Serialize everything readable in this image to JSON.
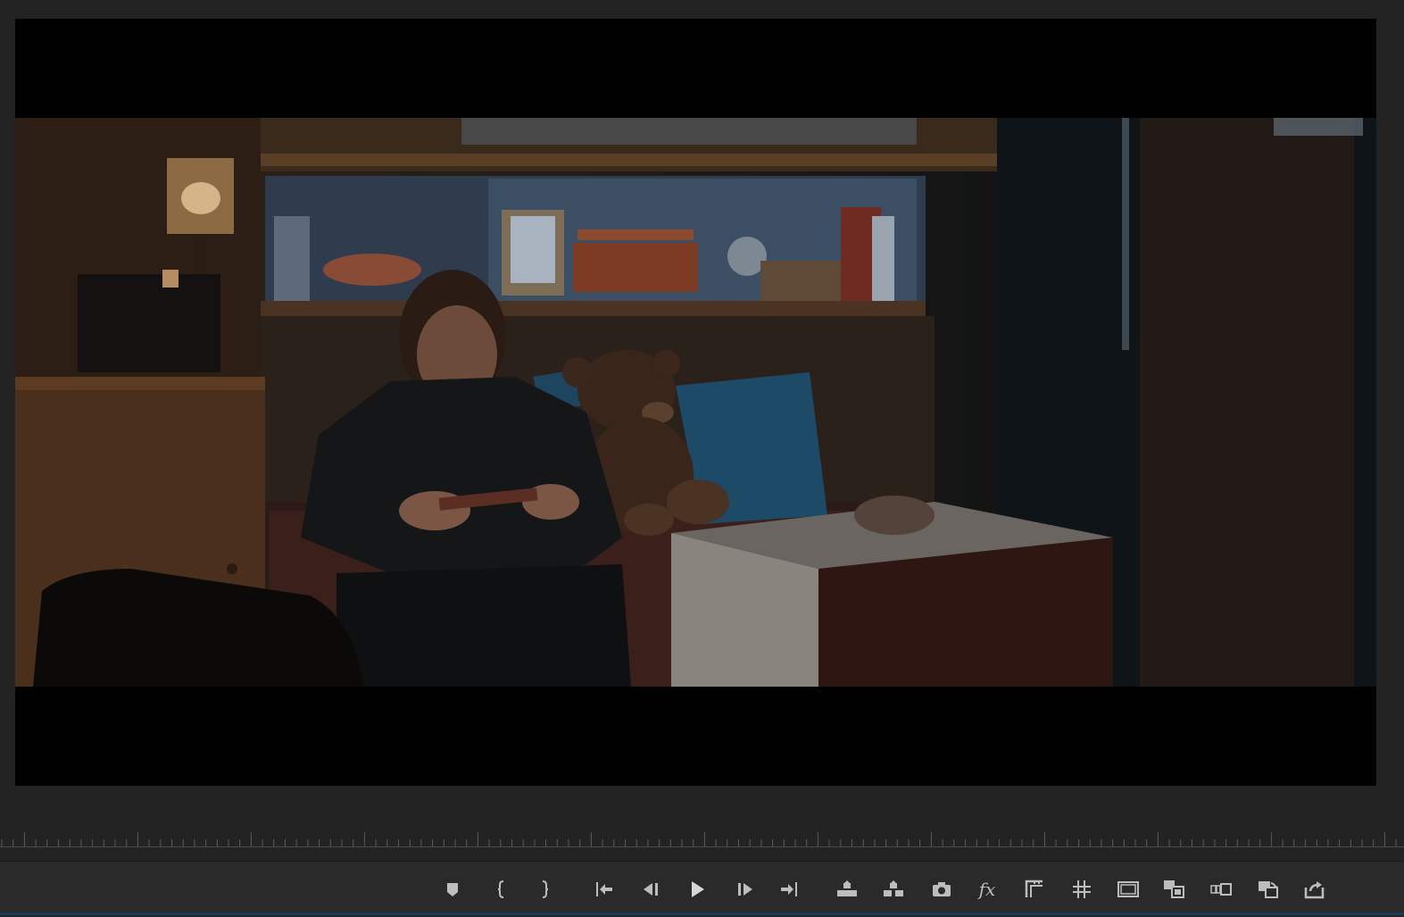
{
  "program_monitor": {
    "frame_description_icon": "video-frame",
    "letterbox": true
  },
  "transport": {
    "buttons": [
      {
        "name": "add-marker-button",
        "icon": "marker-icon"
      },
      {
        "name": "mark-in-button",
        "icon": "mark-in-icon"
      },
      {
        "name": "mark-out-button",
        "icon": "mark-out-icon"
      },
      {
        "name": "go-to-in-button",
        "icon": "go-to-in-icon"
      },
      {
        "name": "step-back-button",
        "icon": "step-back-icon"
      },
      {
        "name": "play-button",
        "icon": "play-icon"
      },
      {
        "name": "step-forward-button",
        "icon": "step-forward-icon"
      },
      {
        "name": "go-to-out-button",
        "icon": "go-to-out-icon"
      },
      {
        "name": "lift-button",
        "icon": "lift-icon"
      },
      {
        "name": "extract-button",
        "icon": "extract-icon"
      },
      {
        "name": "export-frame-button",
        "icon": "camera-icon"
      },
      {
        "name": "effects-button",
        "icon": "fx-icon",
        "label": "fx"
      },
      {
        "name": "safe-margins-button",
        "icon": "safe-margins-icon"
      },
      {
        "name": "grid-button",
        "icon": "grid-icon"
      },
      {
        "name": "show-frame-button",
        "icon": "frame-icon"
      },
      {
        "name": "multi-camera-button",
        "icon": "multicam-icon"
      },
      {
        "name": "comparison-view-button",
        "icon": "comparison-icon"
      },
      {
        "name": "toggle-proxies-button",
        "icon": "proxy-toggle-icon"
      },
      {
        "name": "export-button",
        "icon": "export-icon"
      }
    ]
  },
  "colors": {
    "panel_bg": "#232323",
    "control_bg": "#2a2a2a",
    "icon": "#bdbdbd",
    "accent": "#1f3b5c"
  }
}
